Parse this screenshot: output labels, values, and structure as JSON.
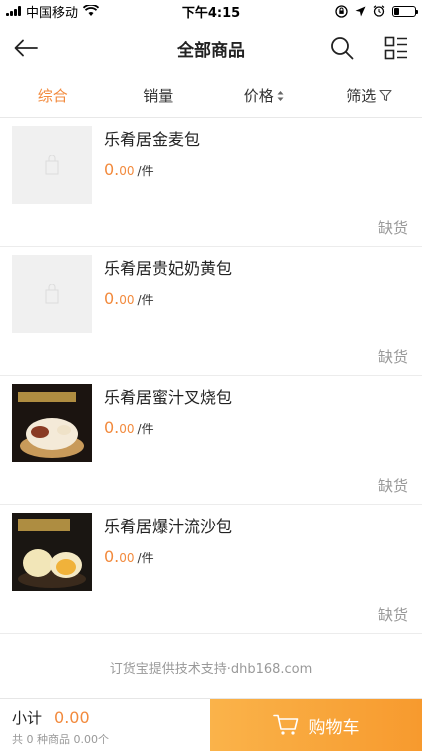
{
  "status_bar": {
    "carrier": "中国移动",
    "time": "下午4:15",
    "icons": [
      "signal-icon",
      "wifi-icon",
      "orientation-lock-icon",
      "location-icon",
      "alarm-icon",
      "battery-icon"
    ]
  },
  "nav": {
    "title": "全部商品",
    "icons": [
      "back-arrow-icon",
      "search-icon",
      "grid-list-icon"
    ]
  },
  "sort_tabs": [
    {
      "label": "综合",
      "active": true
    },
    {
      "label": "销量",
      "active": false
    },
    {
      "label": "价格",
      "active": false,
      "icon": "sort-arrows-icon"
    },
    {
      "label": "筛选",
      "active": false,
      "icon": "filter-icon"
    }
  ],
  "products": [
    {
      "name": "乐肴居金麦包",
      "price_int": "0.",
      "price_dec": "00",
      "unit": "/件",
      "stock": "缺货",
      "image": "placeholder"
    },
    {
      "name": "乐肴居贵妃奶黄包",
      "price_int": "0.",
      "price_dec": "00",
      "unit": "/件",
      "stock": "缺货",
      "image": "placeholder"
    },
    {
      "name": "乐肴居蜜汁叉烧包",
      "price_int": "0.",
      "price_dec": "00",
      "unit": "/件",
      "stock": "缺货",
      "image": "bun-photo"
    },
    {
      "name": "乐肴居爆汁流沙包",
      "price_int": "0.",
      "price_dec": "00",
      "unit": "/件",
      "stock": "缺货",
      "image": "bun-photo"
    }
  ],
  "footer_note": "订货宝提供技术支持·dhb168.com",
  "bottom_bar": {
    "subtotal_label": "小计",
    "subtotal_amount": "0.00",
    "count_text": "共 0 种商品 0.00个",
    "cart_label": "购物车"
  },
  "colors": {
    "accent": "#f28a3d",
    "cart_gradient_start": "#fab34a",
    "cart_gradient_end": "#f79a2e"
  }
}
